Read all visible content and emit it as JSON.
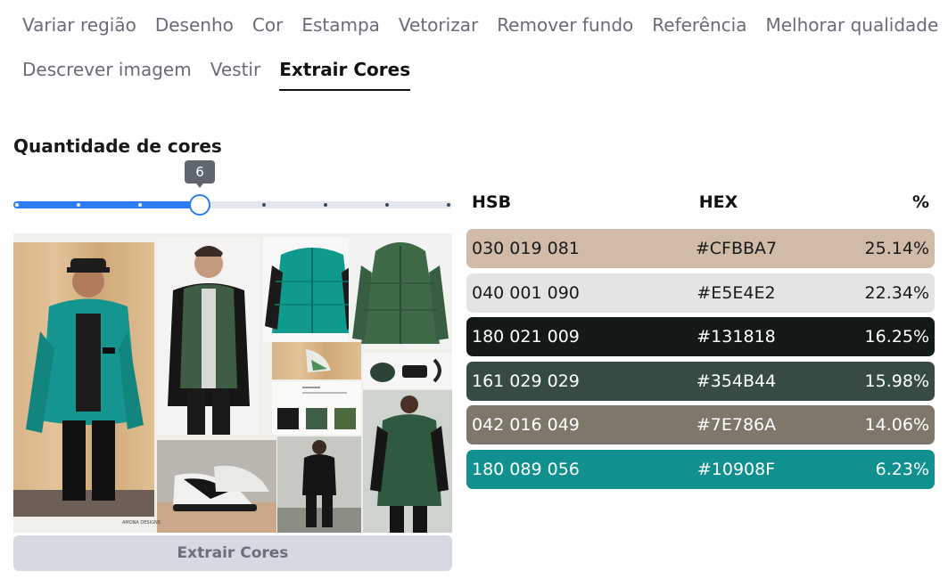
{
  "tabs": [
    {
      "label": "Variar região",
      "active": false
    },
    {
      "label": "Desenho",
      "active": false
    },
    {
      "label": "Cor",
      "active": false
    },
    {
      "label": "Estampa",
      "active": false
    },
    {
      "label": "Vetorizar",
      "active": false
    },
    {
      "label": "Remover fundo",
      "active": false
    },
    {
      "label": "Referência",
      "active": false
    },
    {
      "label": "Melhorar qualidade",
      "active": false
    },
    {
      "label": "Descrever imagem",
      "active": false
    },
    {
      "label": "Vestir",
      "active": false
    },
    {
      "label": "Extrair Cores",
      "active": true
    }
  ],
  "section_title": "Quantidade de cores",
  "slider": {
    "value": "6",
    "value_fraction": 0.4286,
    "steps": 8
  },
  "collage": {
    "caption": "AMONA DESIGNS"
  },
  "extract_button_label": "Extrair Cores",
  "table": {
    "headers": {
      "hsb": "HSB",
      "hex": "HEX",
      "percent": "%"
    },
    "rows": [
      {
        "hsb": "030 019 081",
        "hex": "#CFBBA7",
        "percent": "25.14%",
        "bg": "#CFBBA7",
        "fg": "#1a1a1a"
      },
      {
        "hsb": "040 001 090",
        "hex": "#E5E4E2",
        "percent": "22.34%",
        "bg": "#E5E4E2",
        "fg": "#1a1a1a"
      },
      {
        "hsb": "180 021 009",
        "hex": "#131818",
        "percent": "16.25%",
        "bg": "#131818",
        "fg": "#ffffff"
      },
      {
        "hsb": "161 029 029",
        "hex": "#354B44",
        "percent": "15.98%",
        "bg": "#354B44",
        "fg": "#ffffff"
      },
      {
        "hsb": "042 016 049",
        "hex": "#7E786A",
        "percent": "14.06%",
        "bg": "#7E786A",
        "fg": "#ffffff"
      },
      {
        "hsb": "180 089 056",
        "hex": "#10908F",
        "percent": "6.23%",
        "bg": "#10908F",
        "fg": "#ffffff"
      }
    ]
  },
  "colors": {
    "accent": "#2f7df6",
    "tab_inactive": "#6b6b78",
    "button_bg": "#d6d9e2"
  }
}
